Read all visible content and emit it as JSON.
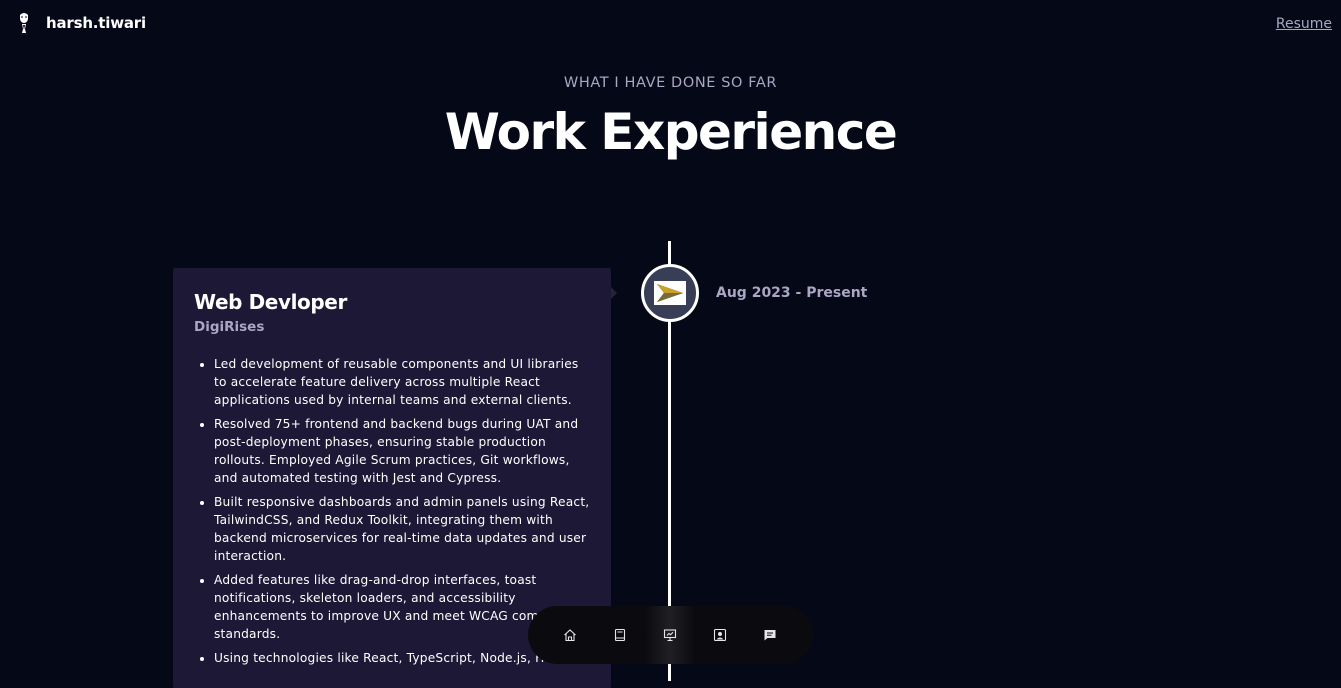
{
  "navbar": {
    "brand": "harsh.tiwari",
    "logo_icon": "portrait-icon",
    "resume_label": "Resume"
  },
  "section": {
    "subtitle": "WHAT I HAVE DONE SO FAR",
    "title": "Work Experience"
  },
  "experience": {
    "job_title": "Web Devloper",
    "company": "DigiRises",
    "date": "Aug 2023 - Present",
    "company_icon": "digirises-logo-icon",
    "points": [
      "Led development of reusable components and UI libraries to accelerate feature delivery across multiple React applications used by internal teams and external clients.",
      "Resolved 75+ frontend and backend bugs during UAT and post-deployment phases, ensuring stable production rollouts. Employed Agile Scrum practices, Git workflows, and automated testing with Jest and Cypress.",
      "Built responsive dashboards and admin panels using React, TailwindCSS, and Redux Toolkit, integrating them with backend microservices for real-time data updates and user interaction.",
      "Added features like drag-and-drop interfaces, toast notifications, skeleton loaders, and accessibility enhancements to improve UX and meet WCAG compliance standards.",
      "Using technologies like React, TypeScript, Node.js, HTML"
    ]
  },
  "dock": {
    "items": [
      "home-icon",
      "book-icon",
      "presentation-icon",
      "contact-card-icon",
      "chat-icon"
    ],
    "active_index": 2
  },
  "colors": {
    "background": "#050816",
    "card": "#1d1836",
    "secondary_text": "#aaa6c3",
    "timeline_icon_bg": "#383e56"
  }
}
